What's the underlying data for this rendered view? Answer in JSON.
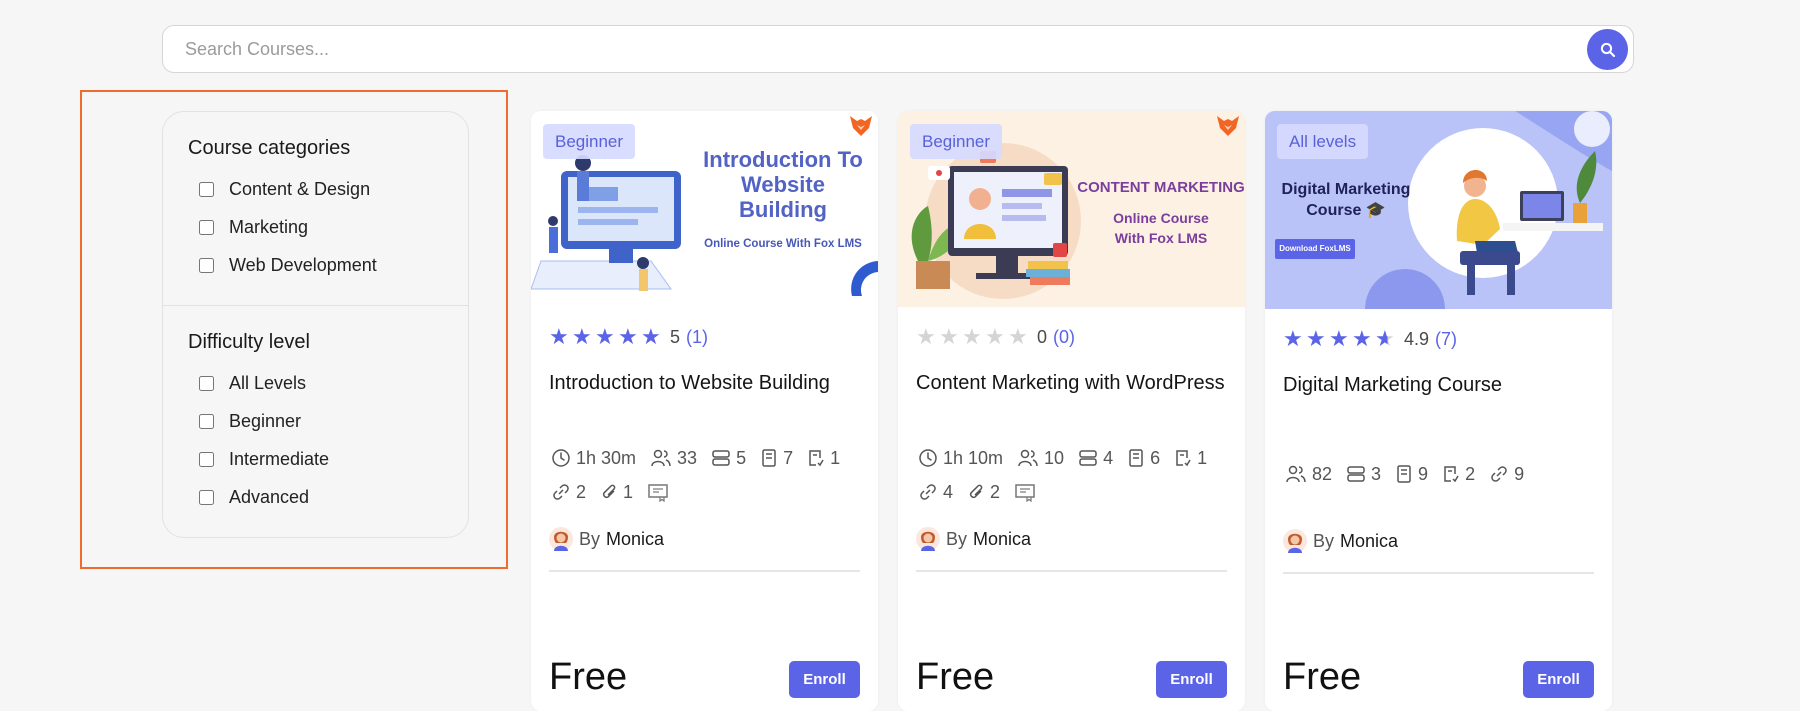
{
  "search": {
    "placeholder": "Search Courses...",
    "button_icon": "search-icon"
  },
  "filters": {
    "categories_title": "Course categories",
    "categories": [
      "Content & Design",
      "Marketing",
      "Web Development"
    ],
    "difficulty_title": "Difficulty level",
    "levels": [
      "All Levels",
      "Beginner",
      "Intermediate",
      "Advanced"
    ]
  },
  "courses": [
    {
      "level": "Beginner",
      "thumb_text": [
        "Introduction To",
        "Website",
        "Building",
        "Online Course With Fox LMS"
      ],
      "rating_score": "5",
      "rating_count": "(1)",
      "rating_value": 5,
      "title": "Introduction to Website Building",
      "meta": {
        "duration": "1h 30m",
        "students": "33",
        "sections": "5",
        "lessons": "7",
        "assignments": "1",
        "links": "2",
        "attachments": "1"
      },
      "by_label": "By",
      "author": "Monica",
      "price": "Free",
      "enroll": "Enroll"
    },
    {
      "level": "Beginner",
      "thumb_text": [
        "CONTENT MARKETING",
        "Online Course",
        "With Fox LMS"
      ],
      "rating_score": "0",
      "rating_count": "(0)",
      "rating_value": 0,
      "title": "Content Marketing with WordPress",
      "meta": {
        "duration": "1h 10m",
        "students": "10",
        "sections": "4",
        "lessons": "6",
        "assignments": "1",
        "links": "4",
        "attachments": "2"
      },
      "by_label": "By",
      "author": "Monica",
      "price": "Free",
      "enroll": "Enroll"
    },
    {
      "level": "All levels",
      "thumb_text": [
        "Digital Marketing",
        "Course",
        "Download FoxLMS"
      ],
      "rating_score": "4.9",
      "rating_count": "(7)",
      "rating_value": 4.9,
      "title": "Digital Marketing Course",
      "meta": {
        "students": "82",
        "sections": "3",
        "lessons": "9",
        "assignments": "2",
        "links": "9"
      },
      "by_label": "By",
      "author": "Monica",
      "price": "Free",
      "enroll": "Enroll"
    }
  ],
  "colors": {
    "accent": "#5b63e6",
    "highlight_border": "#ef6b2f",
    "brand_orange": "#f26522"
  }
}
